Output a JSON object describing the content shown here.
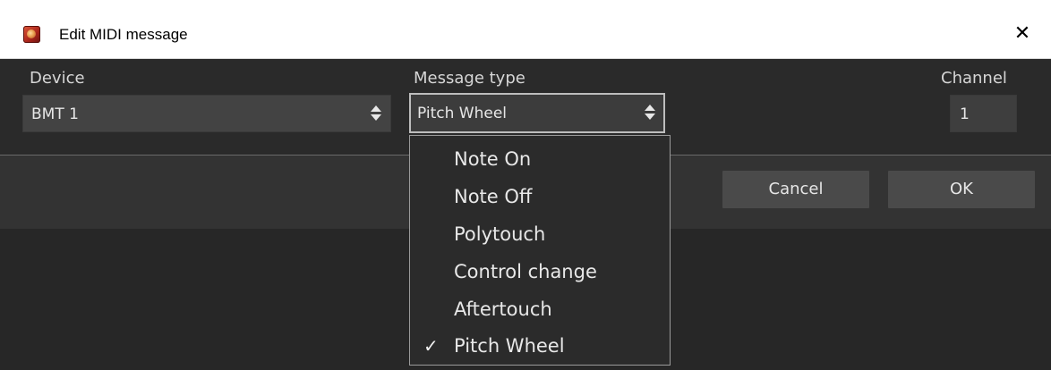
{
  "window": {
    "title": "Edit MIDI message",
    "close_glyph": "✕",
    "app_icon": "gig-performer-app-icon"
  },
  "form": {
    "device": {
      "label": "Device",
      "value": "BMT 1"
    },
    "message_type": {
      "label": "Message type",
      "value": "Pitch Wheel"
    },
    "channel": {
      "label": "Channel",
      "value": "1"
    }
  },
  "buttons": {
    "cancel_label": "Cancel",
    "ok_label": "OK"
  },
  "dropdown": {
    "check_glyph": "✓",
    "items": [
      {
        "label": "Note On",
        "checked": false
      },
      {
        "label": "Note Off",
        "checked": false
      },
      {
        "label": "Polytouch",
        "checked": false
      },
      {
        "label": "Control change",
        "checked": false
      },
      {
        "label": "Aftertouch",
        "checked": false
      },
      {
        "label": "Pitch Wheel",
        "checked": true
      }
    ]
  },
  "colors": {
    "background": "#2a2a2a",
    "field": "#434343",
    "button": "#4a4a4a",
    "text": "#e6e6e6",
    "title_bar": "#ffffff"
  }
}
